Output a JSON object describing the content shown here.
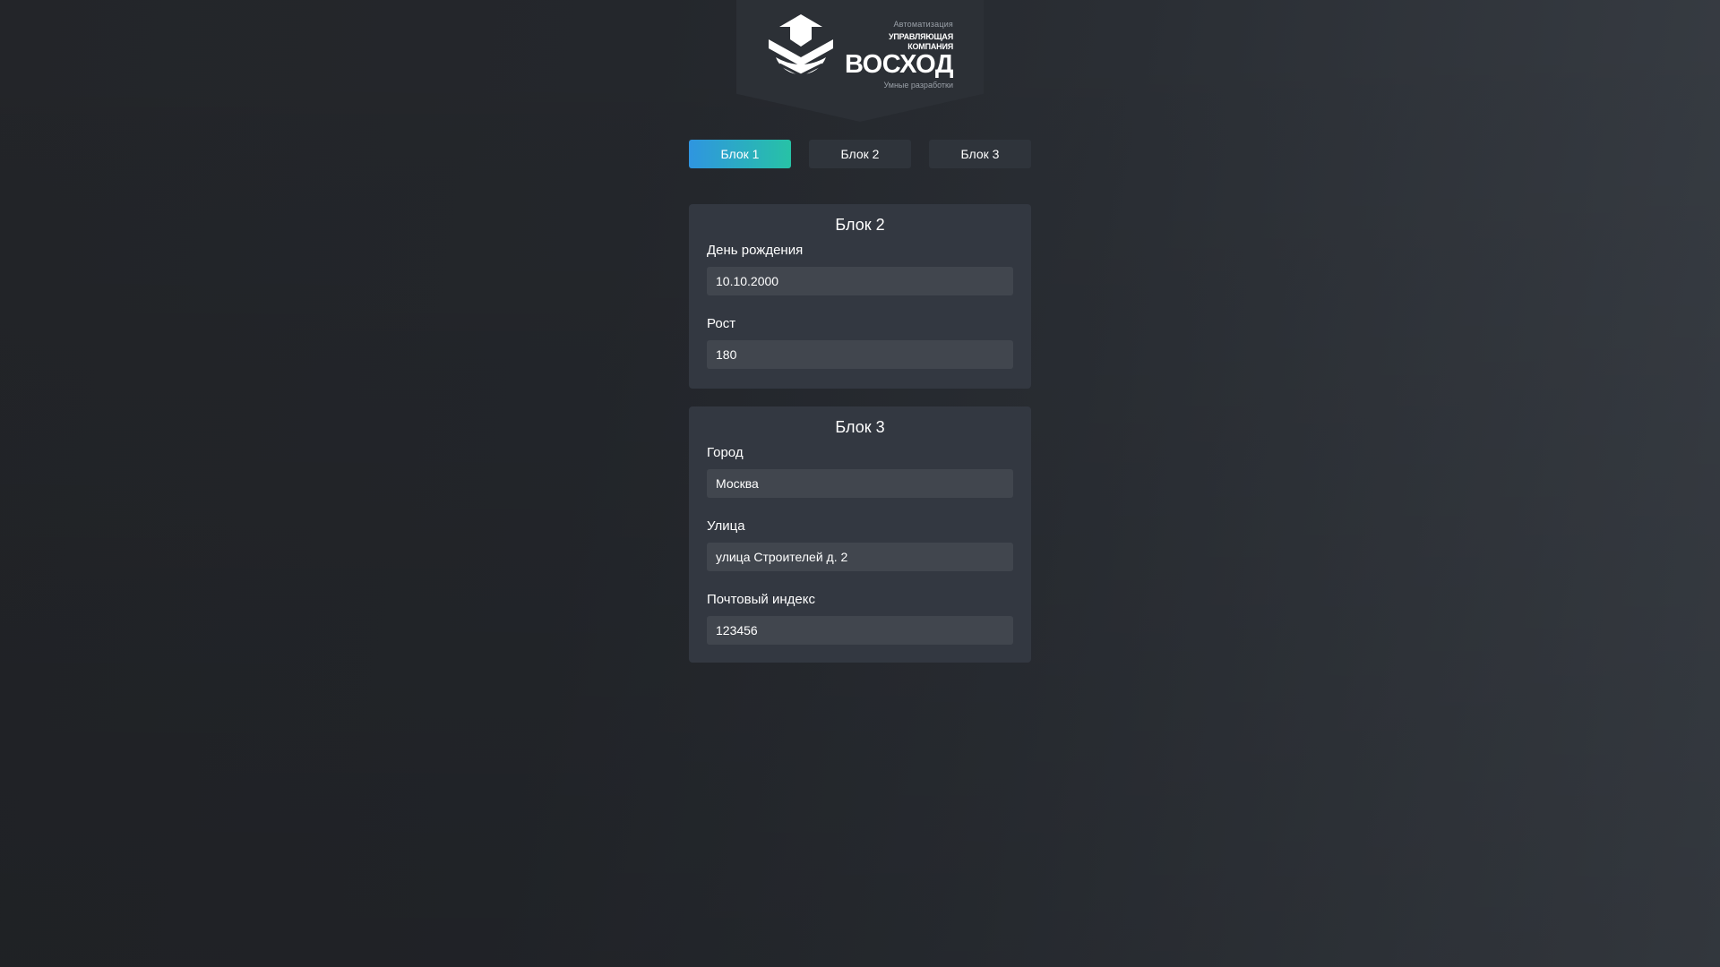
{
  "logo": {
    "top_text": "Автоматизация",
    "company_text": "Управляющая компания",
    "name": "ВОСХОД",
    "bottom_text": "Умные разработки"
  },
  "tabs": [
    {
      "label": "Блок 1",
      "active": true
    },
    {
      "label": "Блок 2",
      "active": false
    },
    {
      "label": "Блок 3",
      "active": false
    }
  ],
  "block2": {
    "title": "Блок 2",
    "fields": [
      {
        "label": "День рождения",
        "value": "10.10.2000"
      },
      {
        "label": "Рост",
        "value": "180"
      }
    ]
  },
  "block3": {
    "title": "Блок 3",
    "fields": [
      {
        "label": "Город",
        "value": "Москва"
      },
      {
        "label": "Улица",
        "value": "улица Строителей д. 2"
      },
      {
        "label": "Почтовый индекс",
        "value": "123456"
      }
    ]
  },
  "colors": {
    "accent_start": "#2f95e0",
    "accent_end": "#27c2a6",
    "card_bg": "#333841",
    "input_bg": "#41464e"
  }
}
